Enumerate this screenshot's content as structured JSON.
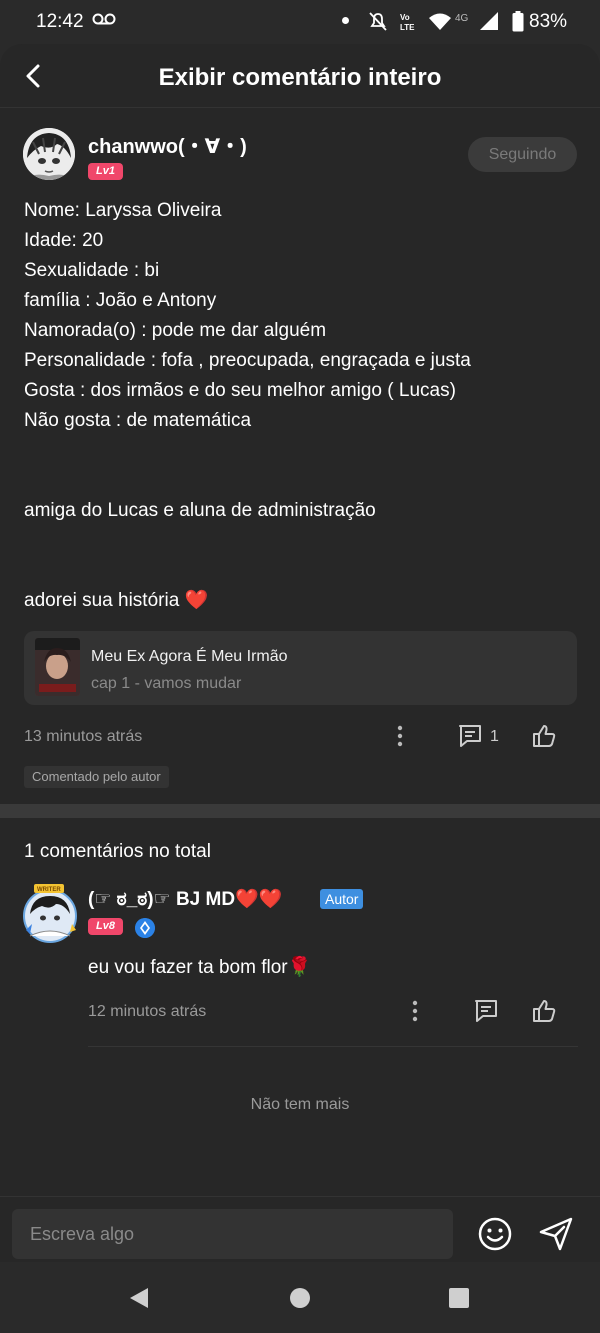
{
  "status_bar": {
    "time": "12:42",
    "battery": "83%",
    "icons": [
      "voicemail-icon",
      "notification-dot",
      "mute-icon",
      "volte-icon",
      "wifi-icon",
      "4g-signal-icon",
      "battery-icon"
    ]
  },
  "header": {
    "title": "Exibir comentário inteiro",
    "back_icon": "chevron-left-icon"
  },
  "main_comment": {
    "username": "chanwwo(・∀・)",
    "level": "Lv1",
    "follow_label": "Seguindo",
    "lines": [
      "Nome: Laryssa Oliveira",
      "Idade: 20",
      "Sexualidade : bi",
      "família : João e Antony",
      "Namorada(o) : pode me dar alguém",
      "Personalidade : fofa , preocupada, engraçada e justa",
      "Gosta : dos irmãos e do seu melhor amigo ( Lucas)",
      "Não gosta : de matemática",
      "",
      "",
      "amiga do Lucas e aluna de administração",
      "",
      "",
      "adorei sua história ❤️"
    ],
    "story": {
      "title": "Meu Ex Agora É Meu Irmão",
      "chapter": "cap 1 - vamos mudar"
    },
    "time": "13 minutos atrás",
    "reply_count": "1",
    "author_tag": "Comentado pelo autor"
  },
  "replies_section": {
    "total_label": "1 comentários no total",
    "replies": [
      {
        "username": "(☞ ಠ_ಠ)☞ BJ MD❤️❤️",
        "badge": "Autor",
        "level": "Lv8",
        "text": "eu vou fazer ta bom flor🌹",
        "time": "12 minutos atrás"
      }
    ],
    "end_label": "Não tem mais"
  },
  "input": {
    "placeholder": "Escreva algo"
  },
  "colors": {
    "background": "#272727",
    "level_badge": "#f0476a",
    "author_badge": "#3e8fe0",
    "heart": "#e23b3b"
  }
}
